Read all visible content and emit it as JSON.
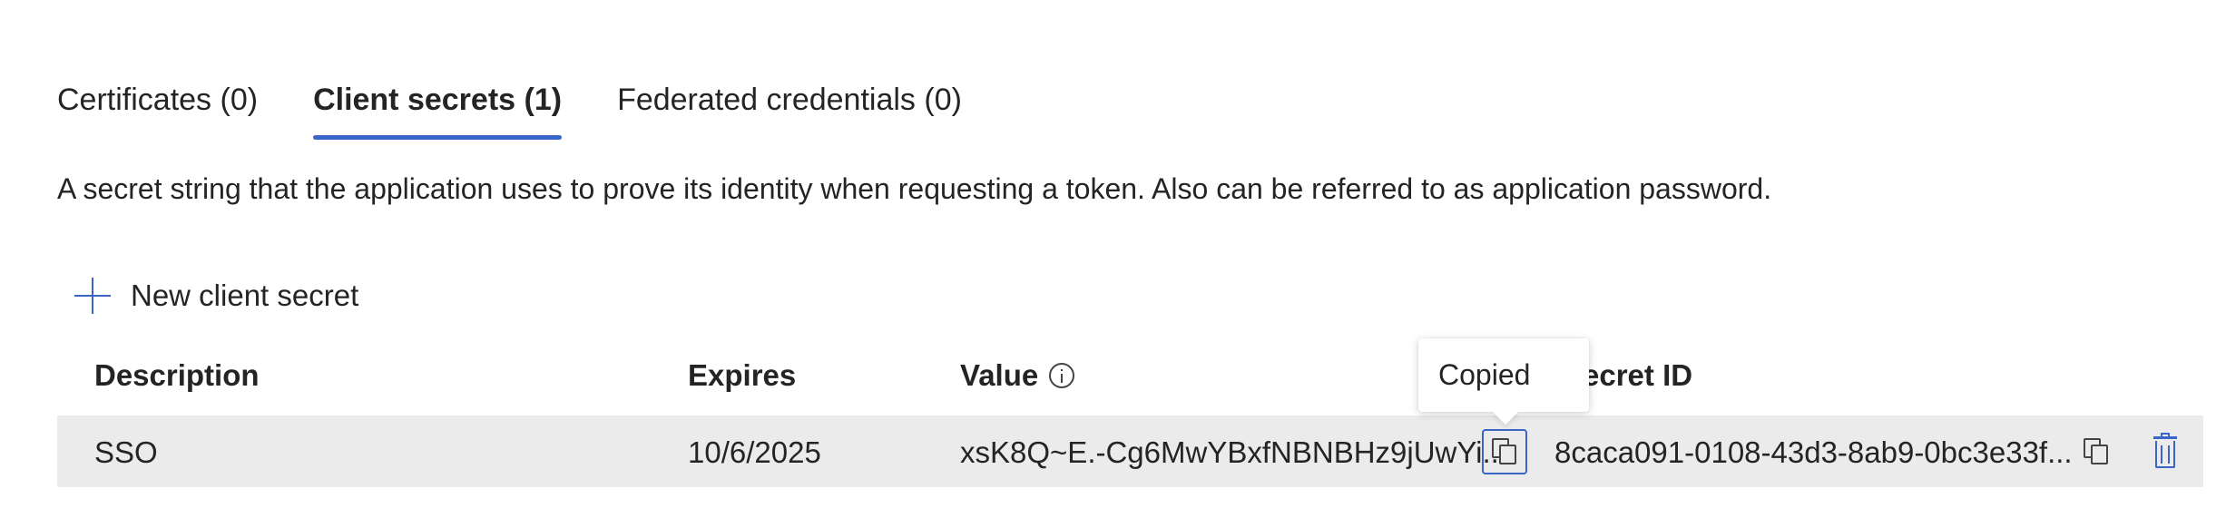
{
  "tabs": [
    {
      "label": "Certificates (0)",
      "active": false
    },
    {
      "label": "Client secrets (1)",
      "active": true
    },
    {
      "label": "Federated credentials (0)",
      "active": false
    }
  ],
  "description": "A secret string that the application uses to prove its identity when requesting a token. Also can be referred to as application password.",
  "toolbar": {
    "new_secret_label": "New client secret",
    "icon": "plus-icon"
  },
  "table": {
    "columns": [
      "Description",
      "Expires",
      "Value",
      "Secret ID"
    ],
    "value_info_icon": "info-icon",
    "rows": [
      {
        "description": "SSO",
        "expires": "10/6/2025",
        "value": "xsK8Q~E.-Cg6MwYBxfNBNBHz9jUwYi....",
        "secret_id": "8caca091-0108-43d3-8ab9-0bc3e33f..."
      }
    ]
  },
  "tooltip": {
    "text": "Copied"
  },
  "colors": {
    "accent": "#3a66c8",
    "row_background": "#ebebeb",
    "text": "#242424"
  }
}
